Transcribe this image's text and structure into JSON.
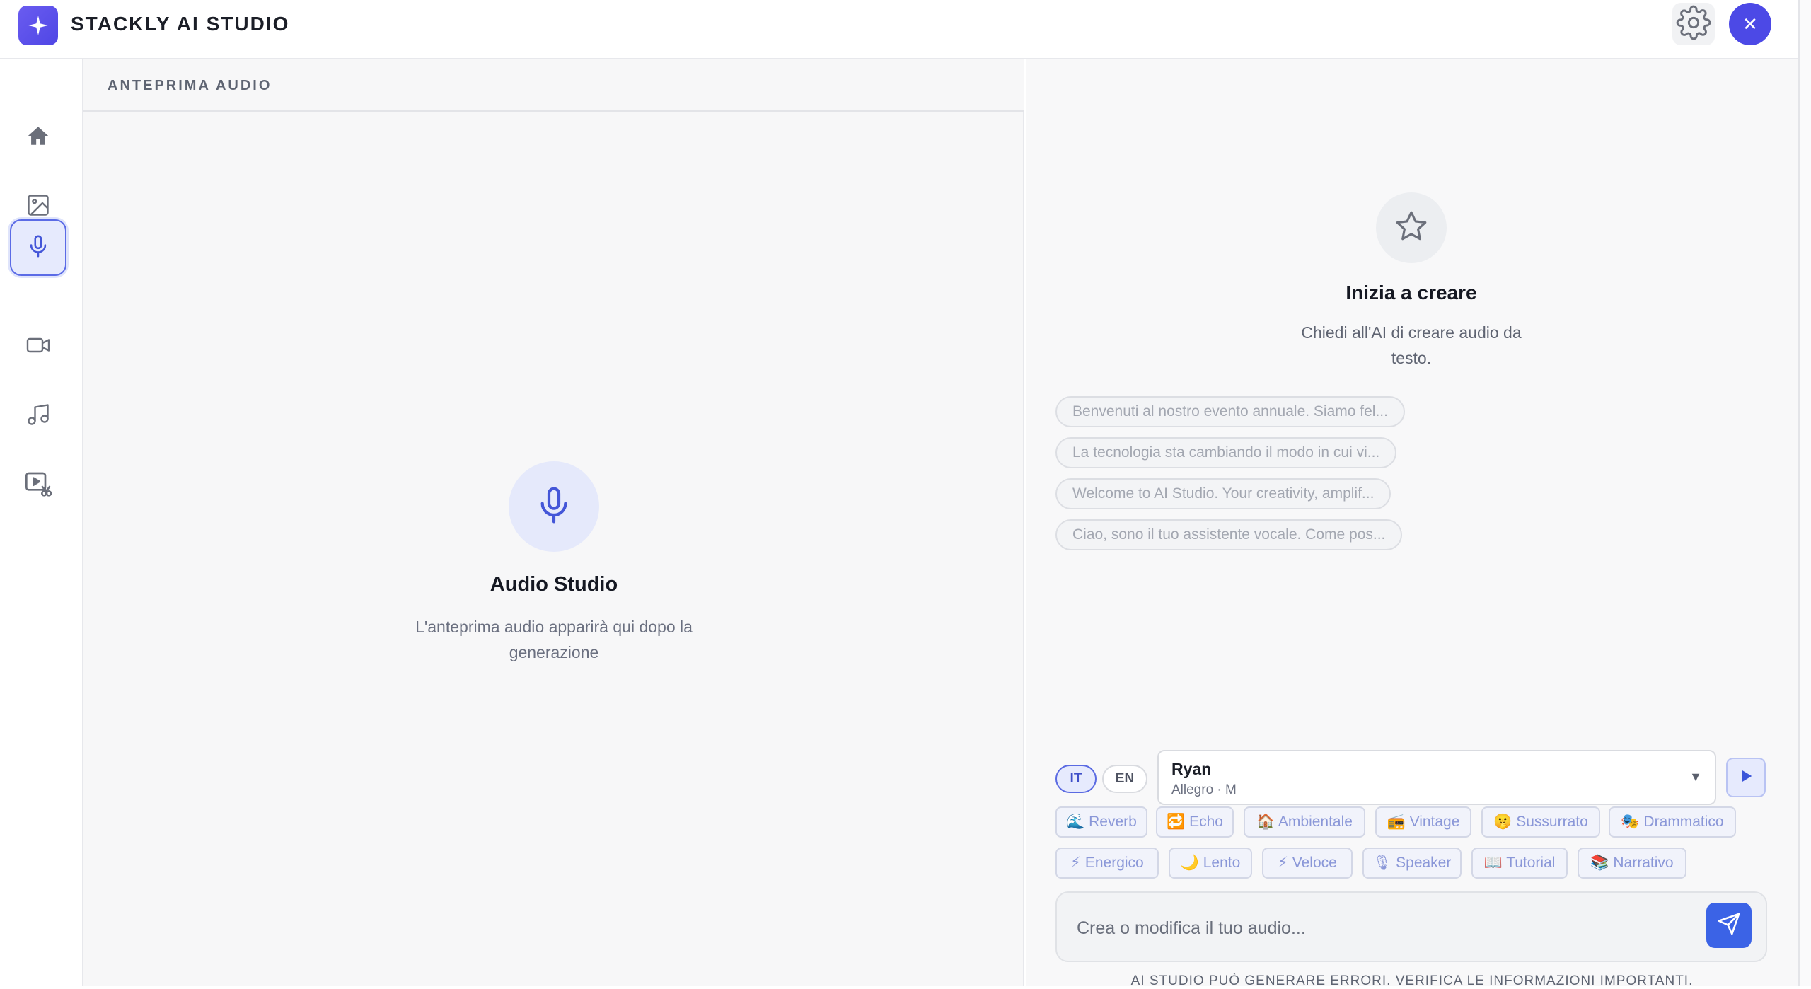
{
  "app": {
    "title": "STACKLY AI STUDIO",
    "logo_icon": "sparkle-icon",
    "accent": "#4f46e5"
  },
  "topbar": {
    "settings_icon": "gear-icon",
    "close_icon": "close-icon",
    "close_glyph": "✕"
  },
  "sidebar": {
    "items": [
      {
        "icon": "home-icon",
        "active": false
      },
      {
        "icon": "image-icon",
        "active": false
      },
      {
        "icon": "microphone-icon",
        "active": true
      },
      {
        "icon": "video-camera-icon",
        "active": false
      },
      {
        "icon": "music-note-icon",
        "active": false
      },
      {
        "icon": "video-edit-icon",
        "active": false
      }
    ]
  },
  "preview": {
    "header": "ANTEPRIMA AUDIO",
    "title": "Audio Studio",
    "subtitle": "L'anteprima audio apparirà qui dopo la generazione"
  },
  "chat": {
    "empty_title": "Inizia a creare",
    "empty_subtitle": "Chiedi all'AI di creare audio da testo.",
    "suggestions": [
      "Benvenuti al nostro evento annuale. Siamo fel...",
      "La tecnologia sta cambiando il modo in cui vi...",
      "Welcome to AI Studio. Your creativity, amplif...",
      "Ciao, sono il tuo assistente vocale. Come pos..."
    ],
    "languages": [
      "IT",
      "EN"
    ],
    "selected_language": "IT",
    "voice": {
      "name": "Ryan",
      "meta": "Allegro · M",
      "arrow": "▼"
    },
    "effects_row1": [
      {
        "emoji": "🌊",
        "label": "Reverb"
      },
      {
        "emoji": "🔁",
        "label": "Echo"
      },
      {
        "emoji": "🏠",
        "label": "Ambientale"
      },
      {
        "emoji": "📻",
        "label": "Vintage"
      },
      {
        "emoji": "🤫",
        "label": "Sussurrato"
      },
      {
        "emoji": "🎭",
        "label": "Drammatico"
      }
    ],
    "effects_row2": [
      {
        "emoji": "⚡",
        "label": "Energico"
      },
      {
        "emoji": "🌙",
        "label": "Lento"
      },
      {
        "emoji": "⚡",
        "label": "Veloce"
      },
      {
        "emoji": "🎙",
        "label": "Speaker"
      },
      {
        "emoji": "📖",
        "label": "Tutorial"
      },
      {
        "emoji": "📚",
        "label": "Narrativo"
      }
    ],
    "input_placeholder": "Crea o modifica il tuo audio...",
    "disclaimer": "AI STUDIO PUÒ GENERARE ERRORI. VERIFICA LE INFORMAZIONI IMPORTANTI."
  }
}
